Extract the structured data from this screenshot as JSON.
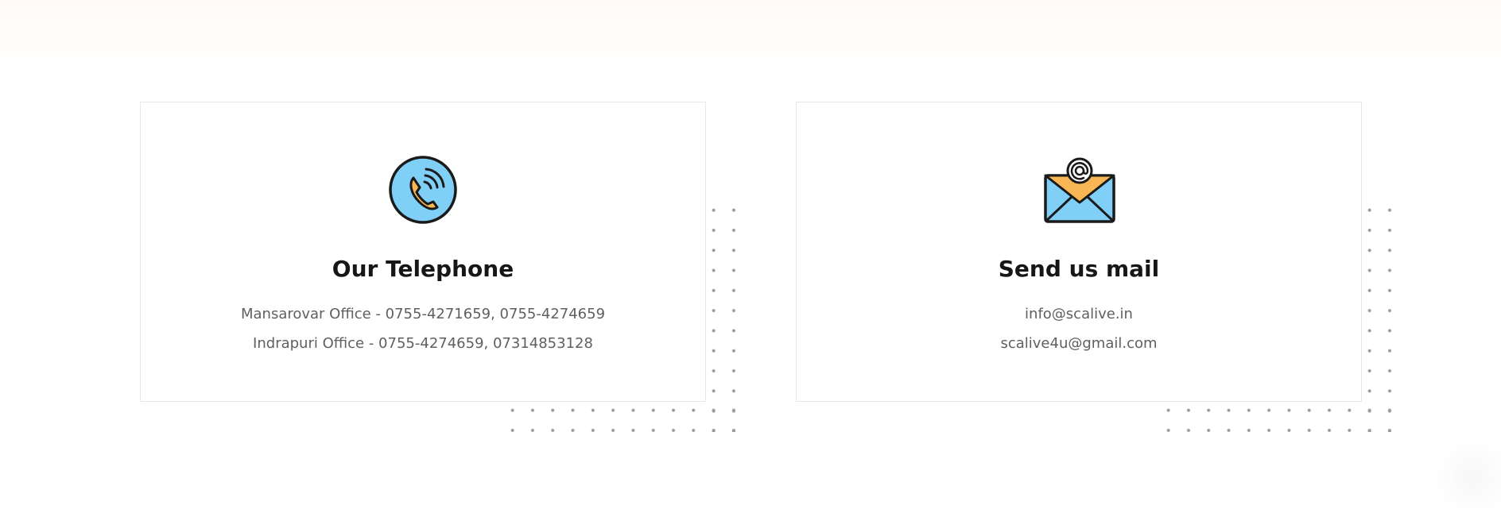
{
  "cards": [
    {
      "icon": "telephone-icon",
      "title": "Our Telephone",
      "lines": [
        "Mansarovar Office - 0755-4271659, 0755-4274659",
        "Indrapuri Office - 0755-4274659, 07314853128"
      ]
    },
    {
      "icon": "mail-envelope-icon",
      "title": "Send us mail",
      "lines": [
        "info@scalive.in",
        "scalive4u@gmail.com"
      ]
    }
  ],
  "colors": {
    "icon_blue": "#7fcff7",
    "icon_orange": "#f9b655",
    "title": "#161616",
    "text": "#5f5f5f",
    "dots": "#9a9a9a"
  }
}
